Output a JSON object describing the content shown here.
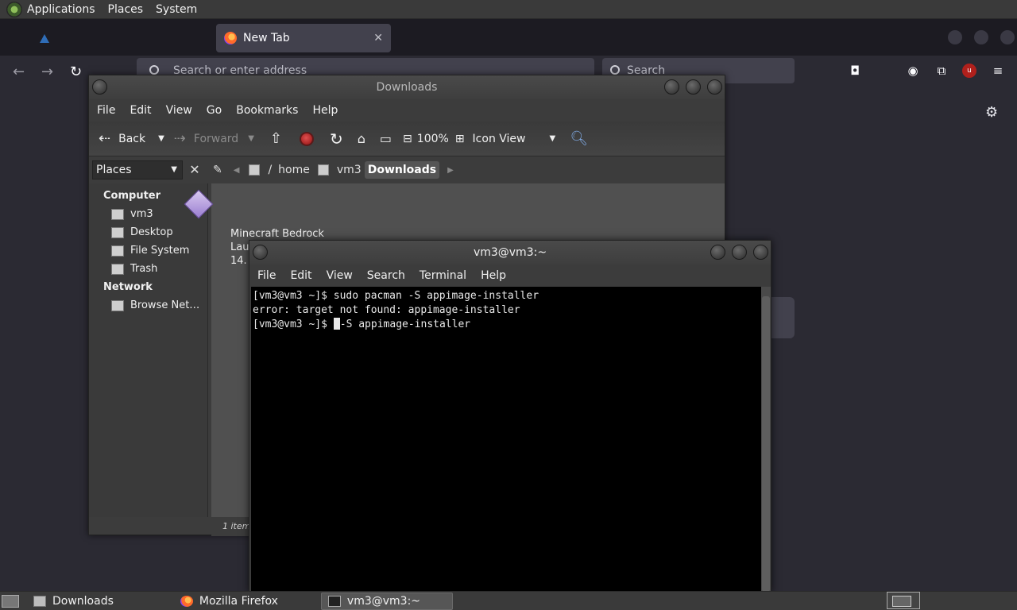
{
  "top_panel": {
    "items": [
      "Applications",
      "Places",
      "System"
    ]
  },
  "firefox": {
    "active_tab_label": "New Tab",
    "url_placeholder": "Search or enter address",
    "search_placeholder": "Search",
    "colors": {
      "background": "#2b2a33",
      "field": "#42414d"
    }
  },
  "file_manager": {
    "title": "Downloads",
    "menu": [
      "File",
      "Edit",
      "View",
      "Go",
      "Bookmarks",
      "Help"
    ],
    "toolbar": {
      "back_label": "Back",
      "forward_label": "Forward",
      "zoom": "100%",
      "view_mode": "Icon View"
    },
    "places_combo": "Places",
    "path": [
      "/",
      "home",
      "vm3",
      "Downloads"
    ],
    "sidebar": {
      "computer_header": "Computer",
      "computer_items": [
        "vm3",
        "Desktop",
        "File System",
        "Trash"
      ],
      "network_header": "Network",
      "network_items": [
        "Browse Net…"
      ]
    },
    "file_label_line1": "Minecraft  Bedrock",
    "file_label_line2": "Laun",
    "file_label_line3": "14.",
    "status": "1 item,"
  },
  "terminal": {
    "title": "vm3@vm3:~",
    "menu": [
      "File",
      "Edit",
      "View",
      "Search",
      "Terminal",
      "Help"
    ],
    "lines": [
      "[vm3@vm3 ~]$ sudo pacman -S appimage-installer",
      "error: target not found: appimage-installer"
    ],
    "prompt": "[vm3@vm3 ~]$ ",
    "current_input": "-S appimage-installer"
  },
  "taskbar": {
    "tasks": [
      "Downloads",
      "Mozilla Firefox",
      "vm3@vm3:~"
    ]
  }
}
